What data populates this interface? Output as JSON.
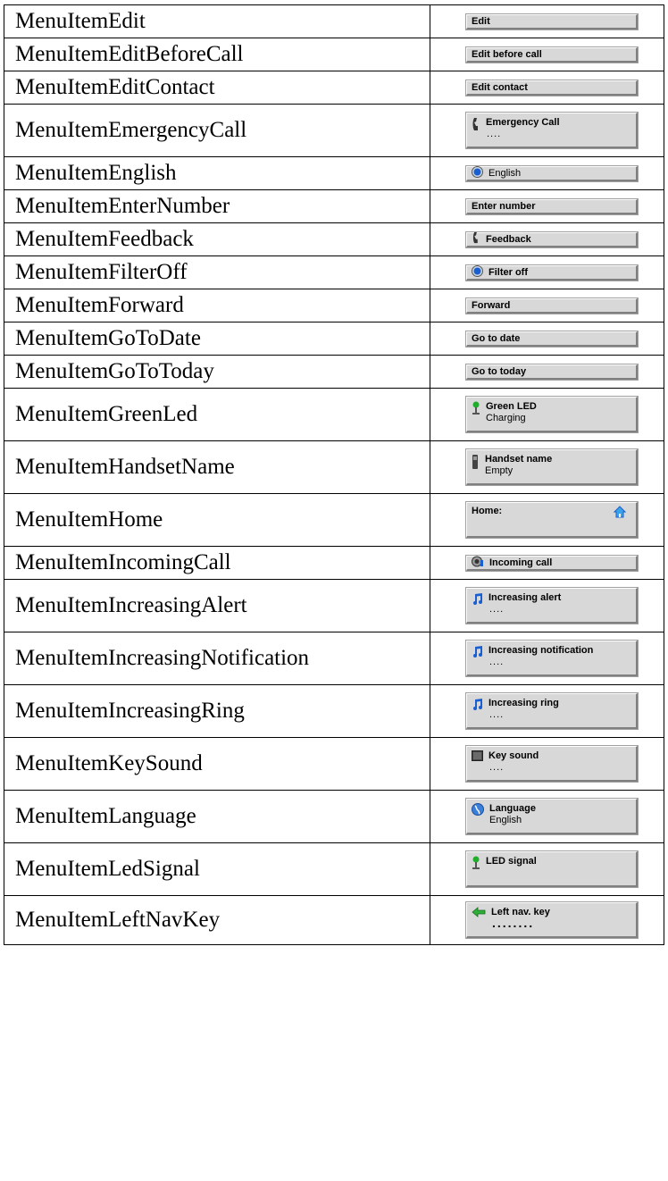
{
  "rows": [
    {
      "name": "MenuItemEdit",
      "label": "Edit"
    },
    {
      "name": "MenuItemEditBeforeCall",
      "label": "Edit before call"
    },
    {
      "name": "MenuItemEditContact",
      "label": "Edit contact"
    },
    {
      "name": "MenuItemEmergencyCall",
      "label": "Emergency Call",
      "sub": "...."
    },
    {
      "name": "MenuItemEnglish",
      "label": "English"
    },
    {
      "name": "MenuItemEnterNumber",
      "label": "Enter number"
    },
    {
      "name": "MenuItemFeedback",
      "label": "Feedback"
    },
    {
      "name": "MenuItemFilterOff",
      "label": "Filter off"
    },
    {
      "name": "MenuItemForward",
      "label": "Forward"
    },
    {
      "name": "MenuItemGoToDate",
      "label": "Go to date"
    },
    {
      "name": "MenuItemGoToToday",
      "label": "Go to today"
    },
    {
      "name": "MenuItemGreenLed",
      "label": "Green LED",
      "sub": "Charging"
    },
    {
      "name": "MenuItemHandsetName",
      "label": "Handset name",
      "sub": "Empty"
    },
    {
      "name": "MenuItemHome",
      "label": "Home:"
    },
    {
      "name": "MenuItemIncomingCall",
      "label": "Incoming call"
    },
    {
      "name": "MenuItemIncreasingAlert",
      "label": "Increasing alert",
      "sub": "...."
    },
    {
      "name": "MenuItemIncreasingNotification",
      "label": "Increasing notification",
      "sub": "...."
    },
    {
      "name": "MenuItemIncreasingRing",
      "label": "Increasing ring",
      "sub": "...."
    },
    {
      "name": "MenuItemKeySound",
      "label": "Key sound",
      "sub": "...."
    },
    {
      "name": "MenuItemLanguage",
      "label": "Language",
      "sub": "English"
    },
    {
      "name": "MenuItemLedSignal",
      "label": "LED signal"
    },
    {
      "name": "MenuItemLeftNavKey",
      "label": "Left nav. key",
      "sub": "........"
    }
  ],
  "icons": {
    "emergency": "phone-handset-icon",
    "english": "radio-button-icon",
    "feedback": "phone-handset-icon",
    "filter": "radio-button-icon",
    "led": "green-led-icon",
    "handset": "handset-icon",
    "home": "house-icon",
    "incoming": "incoming-call-icon",
    "music": "music-note-icon",
    "keysound": "keypad-icon",
    "language": "globe-icon",
    "arrow": "left-arrow-icon"
  },
  "colors": {
    "widget_bg": "#d8d8d8",
    "accent_blue": "#1a5fd0",
    "led_green": "#1fae2b"
  }
}
